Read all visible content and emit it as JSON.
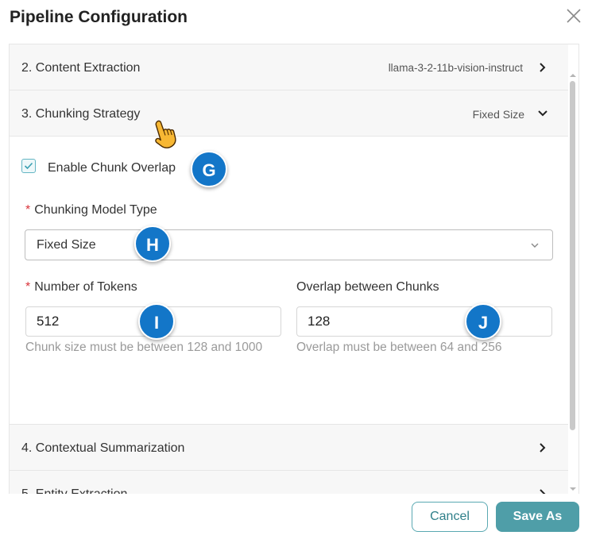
{
  "dialog": {
    "title": "Pipeline Configuration",
    "close_icon": "close-icon"
  },
  "sections": [
    {
      "label": "2. Content Extraction",
      "summary": "llama-3-2-11b-vision-instruct",
      "state": "collapsed"
    },
    {
      "label": "3. Chunking Strategy",
      "summary": "Fixed Size",
      "state": "expanded"
    },
    {
      "label": "4. Contextual Summarization",
      "summary": "",
      "state": "collapsed"
    },
    {
      "label": "5. Entity Extraction",
      "summary": "",
      "state": "collapsed"
    }
  ],
  "chunking": {
    "overlap_checkbox_label": "Enable Chunk Overlap",
    "overlap_checked": true,
    "required_marker": "*",
    "model_type_label": "Chunking Model Type",
    "model_type_value": "Fixed Size",
    "tokens_label": "Number of Tokens",
    "tokens_value": "512",
    "tokens_help": "Chunk size must be between 128 and 1000",
    "overlap_label": "Overlap between Chunks",
    "overlap_value": "128",
    "overlap_help": "Overlap must be between 64 and 256"
  },
  "badges": {
    "g": "G",
    "h": "H",
    "i": "I",
    "j": "J"
  },
  "footer": {
    "cancel_label": "Cancel",
    "save_label": "Save As"
  },
  "colors": {
    "accent": "#4f9ea8",
    "badge": "#1376c8",
    "required": "#d9343b",
    "help_text": "#9a9a9a",
    "header_bg": "#f7f7f7"
  }
}
